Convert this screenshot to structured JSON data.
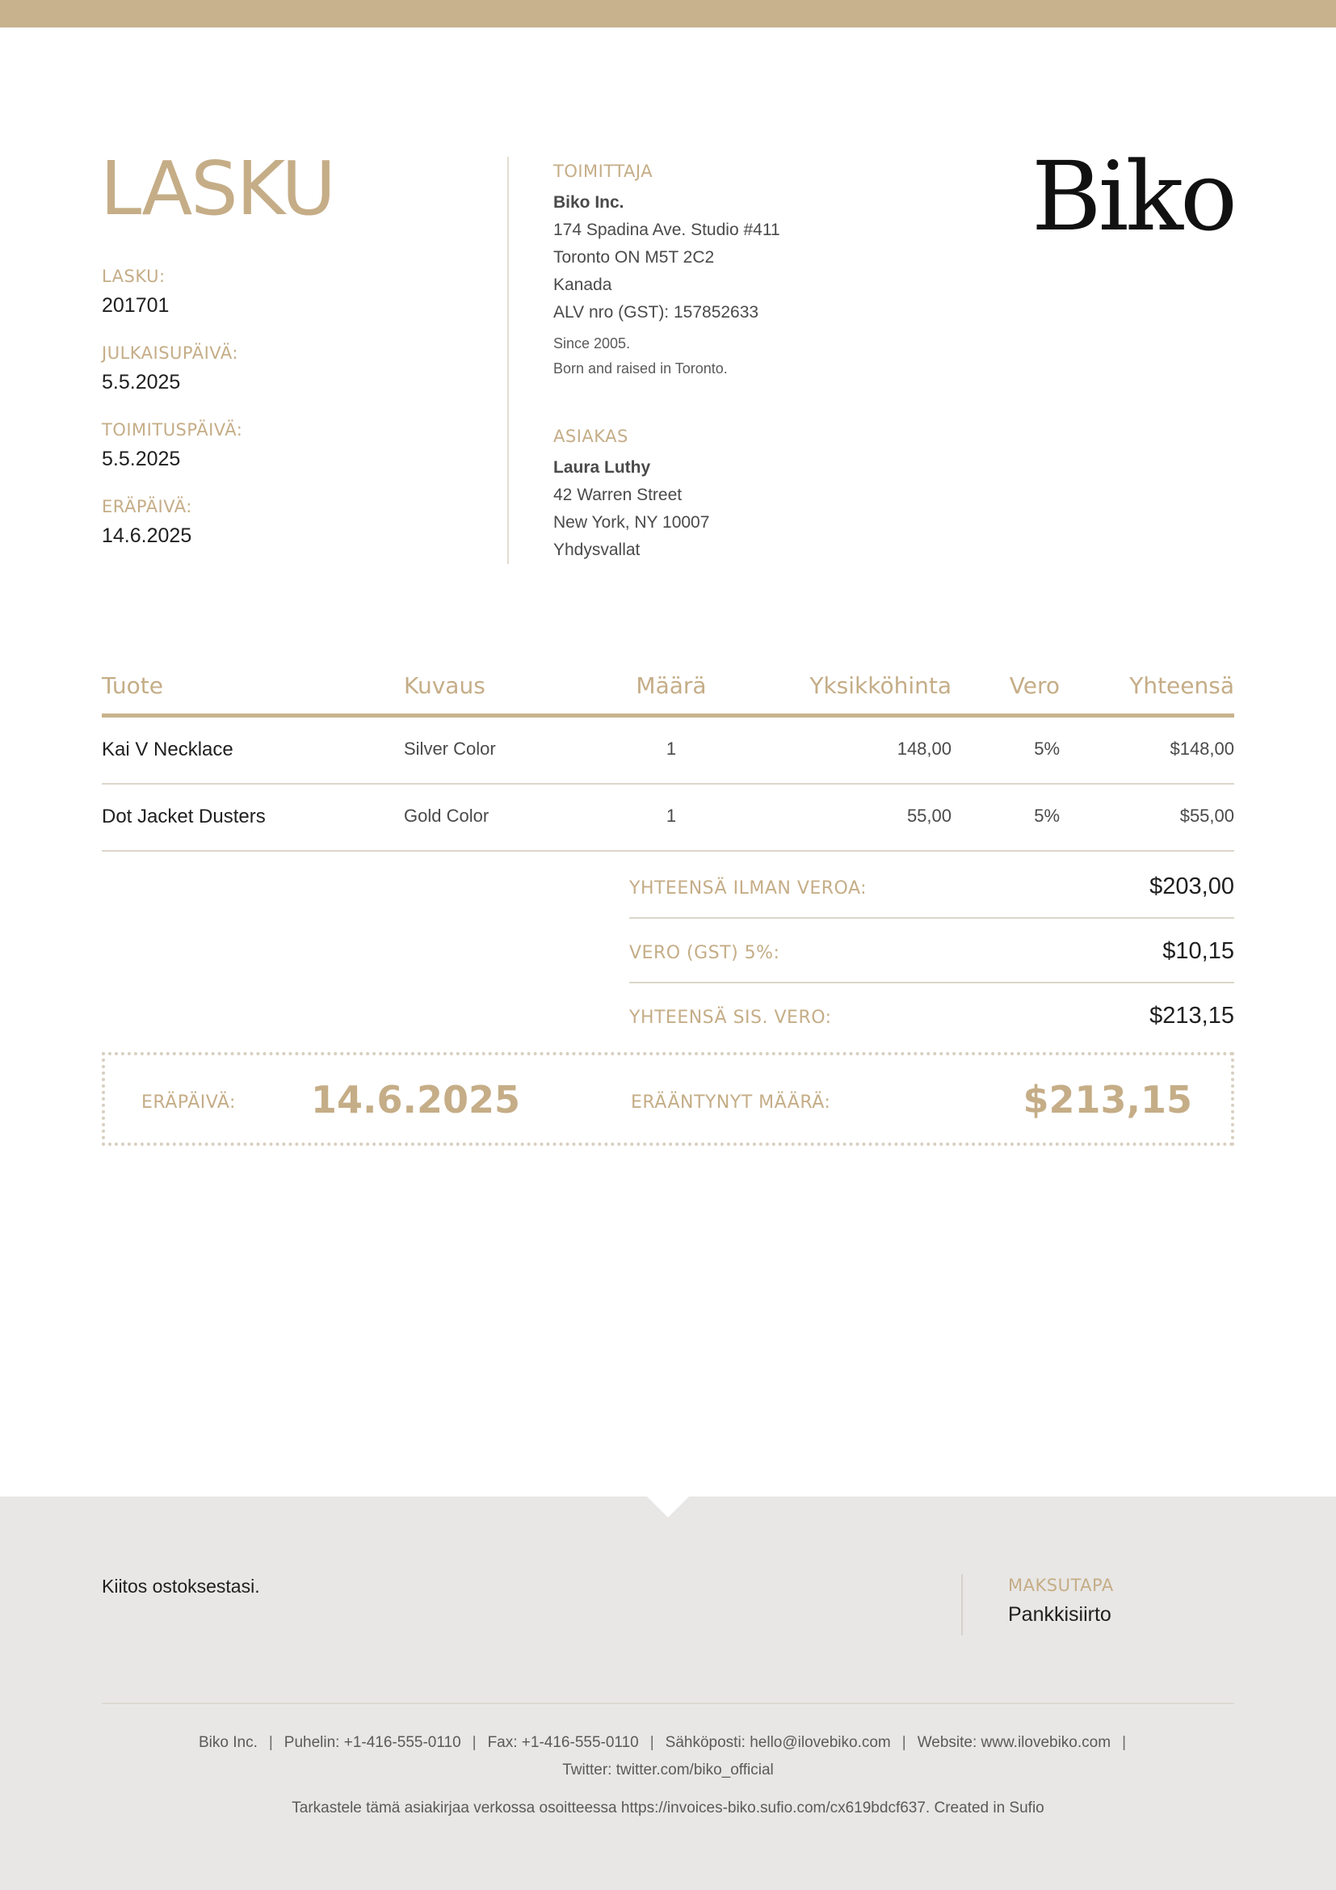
{
  "invoice": {
    "title": "LASKU",
    "fields": [
      {
        "label": "LASKU:",
        "value": "201701"
      },
      {
        "label": "JULKAISUPÄIVÄ:",
        "value": "5.5.2025"
      },
      {
        "label": "TOIMITUSPÄIVÄ:",
        "value": "5.5.2025"
      },
      {
        "label": "ERÄPÄIVÄ:",
        "value": "14.6.2025"
      }
    ]
  },
  "supplier": {
    "label": "TOIMITTAJA",
    "name": "Biko Inc.",
    "lines": [
      "174 Spadina Ave. Studio #411",
      "Toronto ON M5T 2C2",
      "Kanada",
      "ALV nro (GST): 157852633"
    ],
    "notes": [
      "Since 2005.",
      "Born and raised in Toronto."
    ]
  },
  "customer": {
    "label": "ASIAKAS",
    "name": "Laura Luthy",
    "lines": [
      "42 Warren Street",
      "New York, NY 10007",
      "Yhdysvallat"
    ]
  },
  "logo": "Biko",
  "table": {
    "headers": {
      "product": "Tuote",
      "description": "Kuvaus",
      "quantity": "Määrä",
      "unit_price": "Yksikköhinta",
      "tax": "Vero",
      "total": "Yhteensä"
    },
    "rows": [
      {
        "product": "Kai V Necklace",
        "description": "Silver Color",
        "quantity": "1",
        "unit_price": "148,00",
        "tax": "5%",
        "total": "$148,00"
      },
      {
        "product": "Dot Jacket Dusters",
        "description": "Gold Color",
        "quantity": "1",
        "unit_price": "55,00",
        "tax": "5%",
        "total": "$55,00"
      }
    ]
  },
  "totals": [
    {
      "label": "YHTEENSÄ ILMAN VEROA:",
      "amount": "$203,00"
    },
    {
      "label": "VERO (GST) 5%:",
      "amount": "$10,15"
    },
    {
      "label": "YHTEENSÄ SIS. VERO:",
      "amount": "$213,15"
    }
  ],
  "due": {
    "date_label": "ERÄPÄIVÄ:",
    "date": "14.6.2025",
    "amount_label": "ERÄÄNTYNYT MÄÄRÄ:",
    "amount": "$213,15"
  },
  "footer": {
    "thanks": "Kiitos ostoksestasi.",
    "payment_label": "MAKSUTAPA",
    "payment_method": "Pankkisiirto",
    "contacts": [
      "Biko Inc.",
      "Puhelin: +1-416-555-0110",
      "Fax: +1-416-555-0110",
      "Sähköposti: hello@ilovebiko.com",
      "Website: www.ilovebiko.com"
    ],
    "twitter": "Twitter: twitter.com/biko_official",
    "view_online": "Tarkastele tämä asiakirjaa verkossa osoitteessa https://invoices-biko.sufio.com/cx619bdcf637. Created in Sufio"
  },
  "colors": {
    "accent": "#c8b28d",
    "footer_bg": "#e8e7e5"
  }
}
